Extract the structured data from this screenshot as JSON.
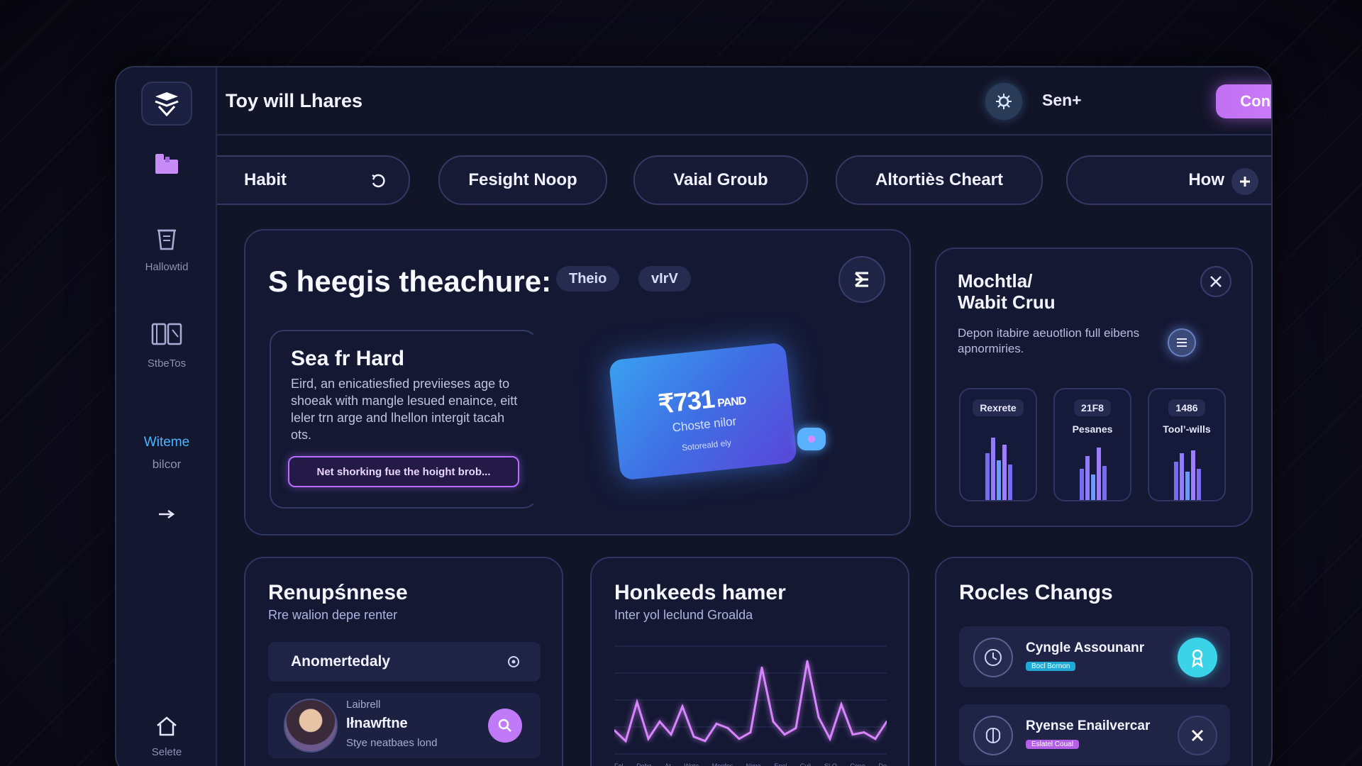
{
  "header": {
    "title": "Toy will Lhares",
    "secondary_label": "Sen+",
    "cta_label": "Concerurad"
  },
  "sidebar": {
    "items": [
      {
        "label": ""
      },
      {
        "label": "Hallowtid"
      },
      {
        "label": "StbeTos"
      },
      {
        "label": "Witeme",
        "sublabel": "bilcor"
      },
      {
        "label": ""
      },
      {
        "label": "Selete"
      }
    ]
  },
  "tabs": [
    {
      "label": "Habit"
    },
    {
      "label": "Fesight Noop"
    },
    {
      "label": "Vaial Groub"
    },
    {
      "label": "Altortiès Cheart"
    },
    {
      "label": "How"
    }
  ],
  "hero": {
    "title": "S heegis theachure:",
    "pills": [
      "Theio",
      "vIrV"
    ],
    "feature": {
      "title": "Sea fr Hard",
      "body": "Eird, an enicatiesfied previieses age to shoeak with mangle lesued enaince, eitt leler trn arge and lhellon intergit tacah ots.",
      "button": "Net shorking fue the hoight brob..."
    },
    "card": {
      "amount": "₹731",
      "unit": "PAND",
      "line1": "Choste nilor",
      "line2": "Sotoreald ely"
    }
  },
  "side_panel": {
    "title_line1": "Mochtla/",
    "title_line2": "Wabit Cruu",
    "description": "Depon itabire aeuotlion full eibens apnormiries.",
    "minis": [
      {
        "badge": "Rexrete",
        "caption": ""
      },
      {
        "badge": "21F8",
        "caption": "Pesanes"
      },
      {
        "badge": "1486",
        "caption": "Tool’-wills"
      }
    ]
  },
  "card_left": {
    "title": "Renupśnnese",
    "subtitle": "Rre walion depe renter",
    "dropdown_label": "Anomertedaly",
    "person": {
      "line1": "Laibrell",
      "name": "Iłnawftne",
      "line3": "Stye neatbaes lond"
    }
  },
  "card_mid": {
    "title": "Honkeeds hamer",
    "subtitle": "Inter yol leclund Groalda",
    "x_labels": [
      "Fol",
      "Dobe",
      "At",
      "Wote",
      "Moofos",
      "Nime",
      "Enol",
      "Culi",
      "SLO",
      "Cone",
      "Do"
    ]
  },
  "chart_data": {
    "type": "line",
    "title": "Honkeeds hamer",
    "xlabel": "",
    "ylabel": "",
    "x": [
      "Fol",
      "Dobe",
      "At",
      "Wote",
      "Moofos",
      "Nime",
      "Enol",
      "Culi",
      "SLO",
      "Cone",
      "Do"
    ],
    "series": [
      {
        "values": [
          22,
          12,
          48,
          14,
          30,
          18,
          44,
          16,
          12,
          28,
          24,
          14,
          20,
          80,
          30,
          18,
          24,
          86,
          34,
          14,
          46,
          18,
          20,
          14,
          30
        ]
      }
    ],
    "ylim": [
      0,
      100
    ],
    "grid": true
  },
  "card_right": {
    "title": "Rocles Changs",
    "items": [
      {
        "name": "Cyngle Assounanr",
        "tag": "Bocl Bornon"
      },
      {
        "name": "Ryense Enailvercar",
        "tag": "Eslatel Coual"
      }
    ]
  },
  "colors": {
    "accent": "#c07af8",
    "cyan": "#3bd3e8",
    "link": "#4fb4ff"
  }
}
